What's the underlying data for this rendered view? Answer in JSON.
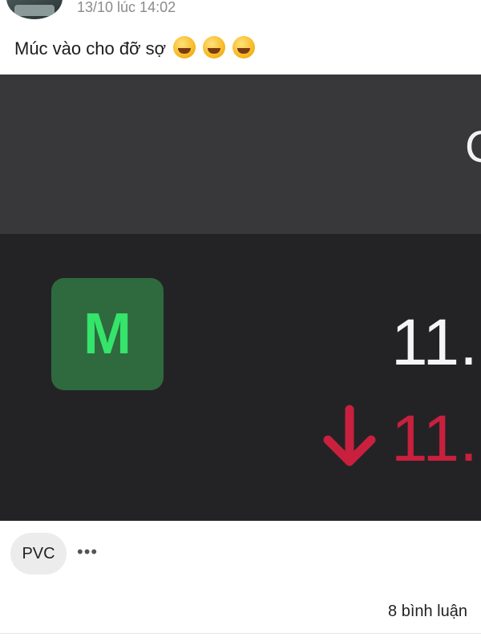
{
  "post": {
    "timestamp": "13/10 lúc 14:02",
    "text": "Múc vào cho đỡ sợ",
    "emojis": [
      "rolling-on-floor-laughing",
      "tears-of-joy",
      "rolling-on-floor-laughing"
    ]
  },
  "image": {
    "header_char": "C",
    "tile_letter": "M",
    "price": "11.",
    "change": "11.",
    "change_direction": "down",
    "colors": {
      "tile_bg": "#2e6a3e",
      "tile_text": "#35e46a",
      "down": "#c8203e",
      "bg": "#232326",
      "header_bg": "#38383a"
    }
  },
  "footer": {
    "tag": "PVC",
    "more": "•••",
    "comments": "8 bình luận"
  }
}
